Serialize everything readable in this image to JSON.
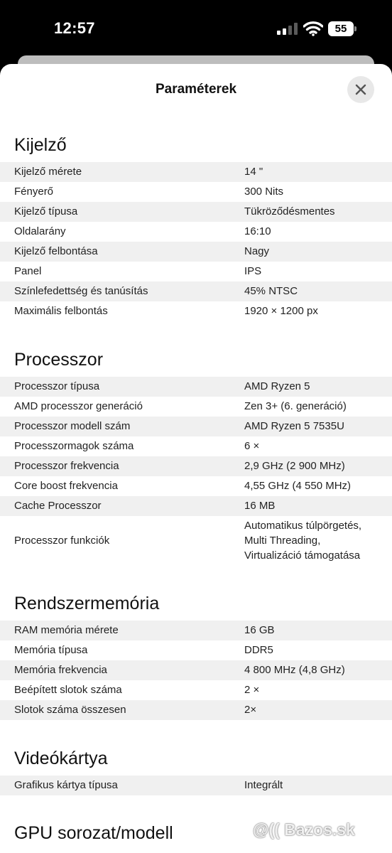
{
  "status_bar": {
    "time": "12:57",
    "battery_level": "55"
  },
  "header": {
    "title": "Paraméterek"
  },
  "sections": [
    {
      "title": "Kijelző",
      "rows": [
        {
          "label": "Kijelző mérete",
          "value": "14 \""
        },
        {
          "label": "Fényerő",
          "value": "300 Nits"
        },
        {
          "label": "Kijelző típusa",
          "value": "Tükröződésmentes"
        },
        {
          "label": "Oldalarány",
          "value": "16:10"
        },
        {
          "label": "Kijelző felbontása",
          "value": "Nagy"
        },
        {
          "label": "Panel",
          "value": "IPS"
        },
        {
          "label": "Színlefedettség és tanúsítás",
          "value": "45% NTSC"
        },
        {
          "label": "Maximális felbontás",
          "value": "1920 × 1200 px"
        }
      ]
    },
    {
      "title": "Processzor",
      "rows": [
        {
          "label": "Processzor típusa",
          "value": "AMD Ryzen 5"
        },
        {
          "label": "AMD processzor generáció",
          "value": "Zen 3+ (6. generáció)"
        },
        {
          "label": "Processzor modell szám",
          "value": "AMD Ryzen 5 7535U"
        },
        {
          "label": "Processzormagok száma",
          "value": "6 ×"
        },
        {
          "label": "Processzor frekvencia",
          "value": "2,9 GHz (2 900 MHz)"
        },
        {
          "label": "Core boost frekvencia",
          "value": "4,55 GHz (4 550 MHz)"
        },
        {
          "label": "Cache Processzor",
          "value": "16 MB"
        },
        {
          "label": "Processzor funkciók",
          "value_lines": [
            "Automatikus túlpörgetés,",
            "Multi Threading,",
            "Virtualizáció támogatása"
          ]
        }
      ]
    },
    {
      "title": "Rendszermemória",
      "rows": [
        {
          "label": "RAM memória mérete",
          "value": "16 GB"
        },
        {
          "label": "Memória típusa",
          "value": "DDR5"
        },
        {
          "label": "Memória frekvencia",
          "value": "4 800 MHz (4,8 GHz)"
        },
        {
          "label": "Beépített slotok száma",
          "value": "2 ×"
        },
        {
          "label": "Slotok száma összesen",
          "value": "2×"
        }
      ]
    },
    {
      "title": "Videókártya",
      "rows": [
        {
          "label": "Grafikus kártya típusa",
          "value": "Integrált"
        }
      ]
    },
    {
      "title": "GPU sorozat/modell",
      "rows": []
    }
  ],
  "watermark": "@(( Bazos.sk"
}
